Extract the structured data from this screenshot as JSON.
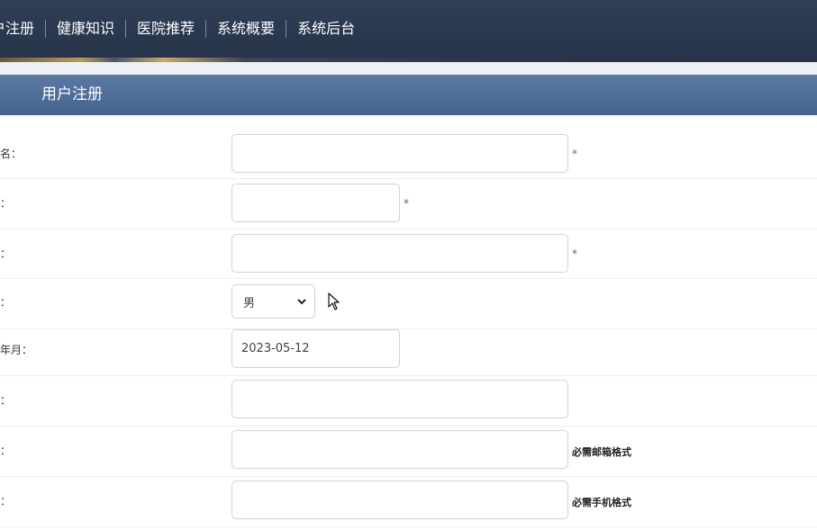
{
  "nav": {
    "items": [
      "户注册",
      "健康知识",
      "医院推荐",
      "系统概要",
      "系统后台"
    ]
  },
  "section": {
    "title": "用户注册"
  },
  "form": {
    "rows": [
      {
        "label": "户名：",
        "required": "*"
      },
      {
        "label": "码：",
        "required": "*"
      },
      {
        "label": "名：",
        "required": "*"
      },
      {
        "label": "别：",
        "select_value": "男"
      },
      {
        "label": "生年月：",
        "value": "2023-05-12"
      },
      {
        "label": "址："
      },
      {
        "label": "箱：",
        "hint": "必需邮箱格式"
      },
      {
        "label": "机：",
        "hint": "必需手机格式"
      }
    ]
  },
  "colors": {
    "nav_bg": "#2b3a50",
    "header_bg": "#4f6e98",
    "border": "#d3d3d3"
  },
  "icons": {
    "select_arrow": "chevron-down-icon",
    "pointer": "mouse-cursor-icon"
  }
}
